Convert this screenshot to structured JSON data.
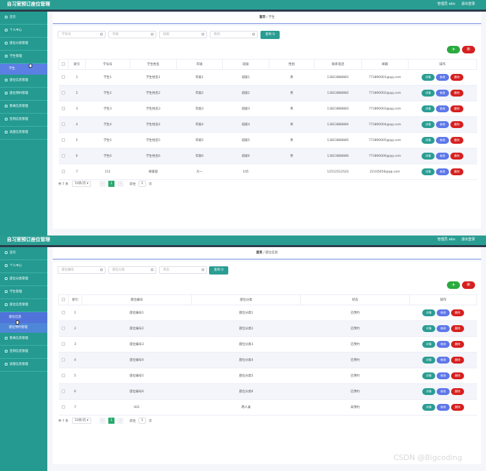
{
  "app": {
    "title": "自习室预订座位管理",
    "user": "管理员 abo",
    "logout": "退出登录"
  },
  "sidebar1": [
    "首页",
    "个人中心",
    "座位分类管理",
    "学生管理",
    "学生",
    "座位信息管理",
    "座位预约管理",
    "暂离信息管理",
    "签到信息管理",
    "退座信息管理"
  ],
  "sidebar2": [
    "首页",
    "个人中心",
    "座位分类管理",
    "学生管理",
    "座位信息管理",
    "座位信息",
    "座位预约管理",
    "暂离信息管理",
    "签到信息管理",
    "退座信息管理"
  ],
  "panel1": {
    "breadcrumb": {
      "home": "首页",
      "sep": "/",
      "current": "学生"
    },
    "search": [
      "学号号",
      "年级",
      "班级",
      "性别"
    ],
    "query": "查询 Q",
    "add": "+",
    "delete": "删",
    "headers": [
      "",
      "索引",
      "学号号",
      "学生姓名",
      "年级",
      "班级",
      "性别",
      "联系电话",
      "邮箱",
      "操作"
    ],
    "rows": [
      [
        "1",
        "学生1",
        "学生姓名1",
        "年级1",
        "班级1",
        "男",
        "13823888881",
        "773890001@qq.com"
      ],
      [
        "2",
        "学生2",
        "学生姓名2",
        "年级2",
        "班级2",
        "男",
        "13823888882",
        "773890002@qq.com"
      ],
      [
        "3",
        "学生3",
        "学生姓名3",
        "年级3",
        "班级3",
        "男",
        "13823888883",
        "773890003@qq.com"
      ],
      [
        "4",
        "学生4",
        "学生姓名4",
        "年级4",
        "班级4",
        "男",
        "13823888884",
        "773890004@qq.com"
      ],
      [
        "5",
        "学生5",
        "学生姓名5",
        "年级5",
        "班级5",
        "男",
        "13823888885",
        "773890005@qq.com"
      ],
      [
        "6",
        "学生6",
        "学生姓名6",
        "年级6",
        "班级6",
        "男",
        "13823888886",
        "773890006@qq.com"
      ],
      [
        "7",
        "111",
        "胡俊俊",
        "大一",
        "105",
        "",
        "12512512522",
        "22335656@qq.com"
      ]
    ],
    "actions": [
      "详情",
      "修改",
      "删除"
    ],
    "pager": {
      "total": "共 7 条",
      "size": "10条/页",
      "page": "1",
      "goto": "前往",
      "goto_val": "1",
      "unit": "页"
    }
  },
  "panel2": {
    "breadcrumb": {
      "home": "首页",
      "sep": "/",
      "current": "座位信息"
    },
    "search": [
      "座位编号",
      "座位分类",
      "状态"
    ],
    "query": "查询 Q",
    "add": "+",
    "delete": "删",
    "headers": [
      "",
      "索引",
      "座位编号",
      "座位分类",
      "状态",
      "操作"
    ],
    "rows": [
      [
        "1",
        "座位编号1",
        "座位分类1",
        "已预约"
      ],
      [
        "2",
        "座位编号2",
        "座位分类2",
        "已预约"
      ],
      [
        "3",
        "座位编号3",
        "座位分类3",
        "已预约"
      ],
      [
        "4",
        "座位编号4",
        "座位分类4",
        "已预约"
      ],
      [
        "5",
        "座位编号5",
        "座位分类5",
        "已预约"
      ],
      [
        "6",
        "座位编号6",
        "座位分类6",
        "已预约"
      ],
      [
        "7",
        "001",
        "两人桌",
        "未预约"
      ]
    ],
    "actions": [
      "详情",
      "修改",
      "删除"
    ],
    "pager": {
      "total": "共 7 条",
      "size": "10条/页",
      "page": "1",
      "goto": "前往",
      "goto_val": "1",
      "unit": "页"
    }
  },
  "watermark": "CSDN @Bigcoding"
}
